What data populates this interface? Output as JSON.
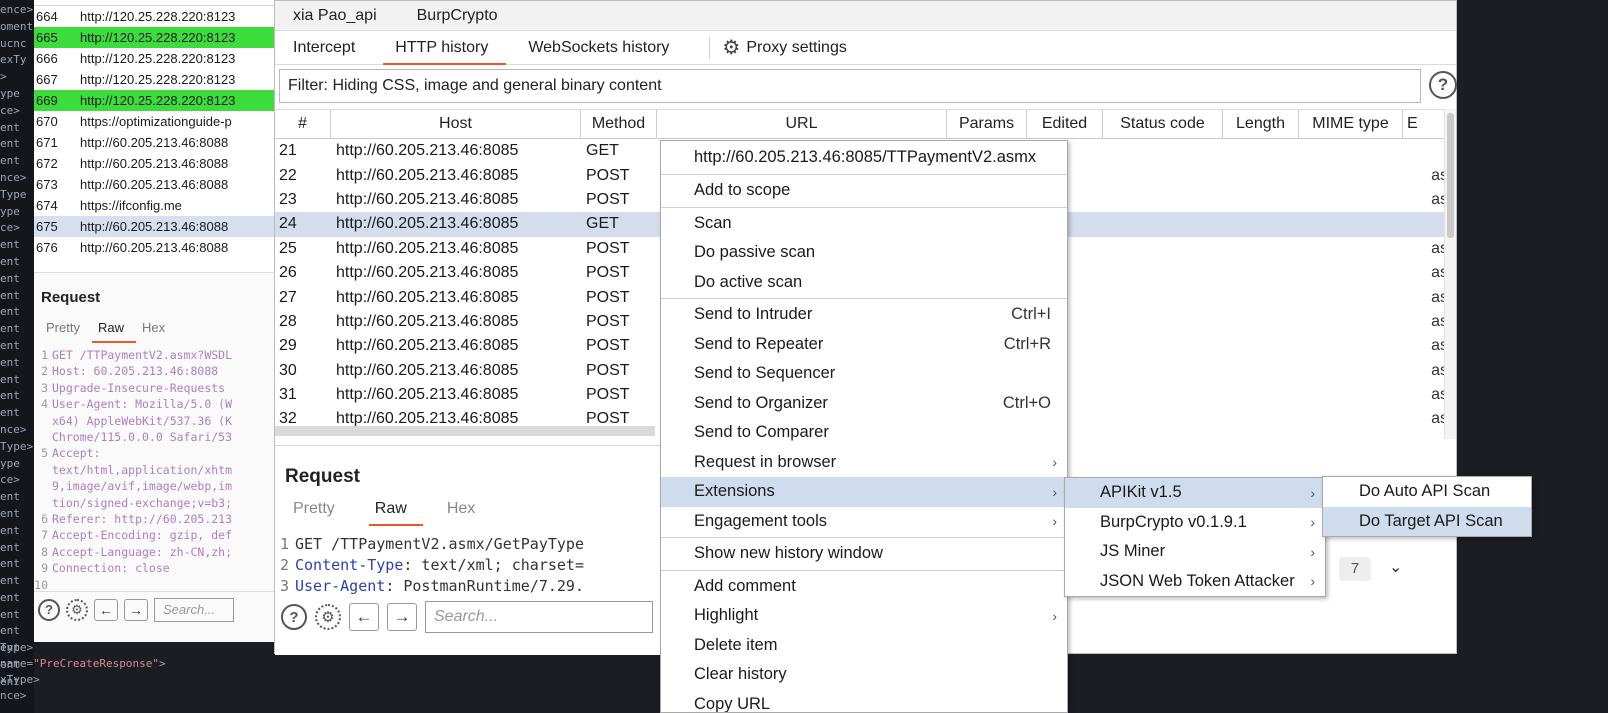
{
  "terminal": {
    "left_lines": [
      "ence>",
      "oment",
      "ucnc",
      "exTy",
      ">",
      "ype",
      "ce>",
      "ent",
      "ent",
      "ent",
      "nce>",
      "Type",
      "ype",
      "ce>",
      "ent",
      "ent",
      "ent",
      "ent",
      "ent",
      "ent",
      "ent",
      "ent",
      "ent",
      "ent",
      "ent",
      "nce>",
      "Type>",
      "ype",
      "ce>",
      "ent",
      "ent",
      "ent",
      "ent",
      "ent",
      "ent",
      "ent",
      "ent",
      "ent",
      "ent",
      "ent",
      "ent"
    ],
    "bottom_lines": [
      "Type>",
      "name=\"PreCreateResponse\">",
      "xType>",
      "nce>"
    ]
  },
  "bg_window": {
    "header_host": "Host",
    "rows": [
      {
        "num": "664",
        "host": "http://120.25.228.220:8123",
        "style": ""
      },
      {
        "num": "665",
        "host": "http://120.25.228.220:8123",
        "style": "green"
      },
      {
        "num": "666",
        "host": "http://120.25.228.220:8123",
        "style": ""
      },
      {
        "num": "667",
        "host": "http://120.25.228.220:8123",
        "style": ""
      },
      {
        "num": "669",
        "host": "http://120.25.228.220:8123",
        "style": "green"
      },
      {
        "num": "670",
        "host": "https://optimizationguide-p",
        "style": ""
      },
      {
        "num": "671",
        "host": "http://60.205.213.46:8088",
        "style": ""
      },
      {
        "num": "672",
        "host": "http://60.205.213.46:8088",
        "style": ""
      },
      {
        "num": "673",
        "host": "http://60.205.213.46:8088",
        "style": ""
      },
      {
        "num": "674",
        "host": "https://ifconfig.me",
        "style": ""
      },
      {
        "num": "675",
        "host": "http://60.205.213.46:8088",
        "style": "sel"
      },
      {
        "num": "676",
        "host": "http://60.205.213.46:8088",
        "style": ""
      }
    ],
    "request_title": "Request",
    "tabs": [
      "Pretty",
      "Raw",
      "Hex"
    ],
    "active_tab": "Raw",
    "code": [
      {
        "ln": "1",
        "text": "GET /TTPaymentV2.asmx?WSDL"
      },
      {
        "ln": "2",
        "text": "Host: 60.205.213.46:8088"
      },
      {
        "ln": "3",
        "text": "Upgrade-Insecure-Requests"
      },
      {
        "ln": "4",
        "text": "User-Agent: Mozilla/5.0 (W"
      },
      {
        "ln": "",
        "text": "x64) AppleWebKit/537.36 (K"
      },
      {
        "ln": "",
        "text": "Chrome/115.0.0.0 Safari/53"
      },
      {
        "ln": "5",
        "text": "Accept:"
      },
      {
        "ln": "",
        "text": "text/html,application/xhtm"
      },
      {
        "ln": "",
        "text": "9,image/avif,image/webp,im"
      },
      {
        "ln": "",
        "text": "tion/signed-exchange;v=b3;"
      },
      {
        "ln": "6",
        "text": "Referer: http://60.205.213"
      },
      {
        "ln": "7",
        "text": "Accept-Encoding: gzip, def"
      },
      {
        "ln": "8",
        "text": "Accept-Language: zh-CN,zh;"
      },
      {
        "ln": "9",
        "text": "Connection: close"
      },
      {
        "ln": "10",
        "text": ""
      }
    ],
    "search_placeholder": "Search..."
  },
  "main": {
    "top_tabs": [
      "xia Pao_api",
      "BurpCrypto"
    ],
    "sub_tabs": [
      "Intercept",
      "HTTP history",
      "WebSockets history"
    ],
    "active_sub_tab": "HTTP history",
    "proxy_settings": "Proxy settings",
    "filter_text": "Filter: Hiding CSS, image and general binary content",
    "columns": [
      "#",
      "Host",
      "Method",
      "URL",
      "Params",
      "Edited",
      "Status code",
      "Length",
      "MIME type",
      "E"
    ],
    "rows": [
      {
        "num": "21",
        "host": "http://60.205.213.46:8085",
        "method": "GET",
        "mime": ""
      },
      {
        "num": "22",
        "host": "http://60.205.213.46:8085",
        "method": "POST",
        "mime": "as"
      },
      {
        "num": "23",
        "host": "http://60.205.213.46:8085",
        "method": "POST",
        "mime": "as"
      },
      {
        "num": "24",
        "host": "http://60.205.213.46:8085",
        "method": "GET",
        "mime": ""
      },
      {
        "num": "25",
        "host": "http://60.205.213.46:8085",
        "method": "POST",
        "mime": "as"
      },
      {
        "num": "26",
        "host": "http://60.205.213.46:8085",
        "method": "POST",
        "mime": "as"
      },
      {
        "num": "27",
        "host": "http://60.205.213.46:8085",
        "method": "POST",
        "mime": "as"
      },
      {
        "num": "28",
        "host": "http://60.205.213.46:8085",
        "method": "POST",
        "mime": "as"
      },
      {
        "num": "29",
        "host": "http://60.205.213.46:8085",
        "method": "POST",
        "mime": "as"
      },
      {
        "num": "30",
        "host": "http://60.205.213.46:8085",
        "method": "POST",
        "mime": "as"
      },
      {
        "num": "31",
        "host": "http://60.205.213.46:8085",
        "method": "POST",
        "mime": "as"
      },
      {
        "num": "32",
        "host": "http://60.205.213.46:8085",
        "method": "POST",
        "mime": "as"
      }
    ],
    "selected_row": "24",
    "request_title": "Request",
    "req_tabs": [
      "Pretty",
      "Raw",
      "Hex"
    ],
    "req_active_tab": "Raw",
    "req_code": [
      {
        "ln": "1",
        "key": "",
        "text": "GET /TTPaymentV2.asmx/GetPayType"
      },
      {
        "ln": "2",
        "key": "Content-Type",
        "text": ": text/xml; charset="
      },
      {
        "ln": "3",
        "key": "User-Agent",
        "text": ": PostmanRuntime/7.29."
      }
    ],
    "search_placeholder": "Search...",
    "count_badge": "7"
  },
  "context_menu": {
    "url_item": "http://60.205.213.46:8085/TTPaymentV2.asmx",
    "groups": [
      [
        {
          "label": "Add to scope"
        }
      ],
      [
        {
          "label": "Scan"
        },
        {
          "label": "Do passive scan"
        },
        {
          "label": "Do active scan"
        }
      ],
      [
        {
          "label": "Send to Intruder",
          "shortcut": "Ctrl+I"
        },
        {
          "label": "Send to Repeater",
          "shortcut": "Ctrl+R"
        },
        {
          "label": "Send to Sequencer"
        },
        {
          "label": "Send to Organizer",
          "shortcut": "Ctrl+O"
        },
        {
          "label": "Send to Comparer"
        },
        {
          "label": "Request in browser",
          "submenu": true
        },
        {
          "label": "Extensions",
          "submenu": true,
          "highlight": true
        },
        {
          "label": "Engagement tools",
          "submenu": true
        }
      ],
      [
        {
          "label": "Show new history window"
        }
      ],
      [
        {
          "label": "Add comment"
        },
        {
          "label": "Highlight",
          "submenu": true
        },
        {
          "label": "Delete item"
        },
        {
          "label": "Clear history"
        },
        {
          "label": "Copy URL"
        }
      ]
    ]
  },
  "extensions_menu": [
    {
      "label": "APIKit v1.5",
      "highlight": true
    },
    {
      "label": "BurpCrypto v0.1.9.1"
    },
    {
      "label": "JS Miner"
    },
    {
      "label": "JSON Web Token Attacker"
    }
  ],
  "apikit_menu": [
    {
      "label": "Do Auto API Scan"
    },
    {
      "label": "Do Target API Scan",
      "highlight": true
    }
  ],
  "colors": {
    "accent": "#e85a2a",
    "highlight": "#3ddc3d",
    "selection": "#d3ddec"
  }
}
